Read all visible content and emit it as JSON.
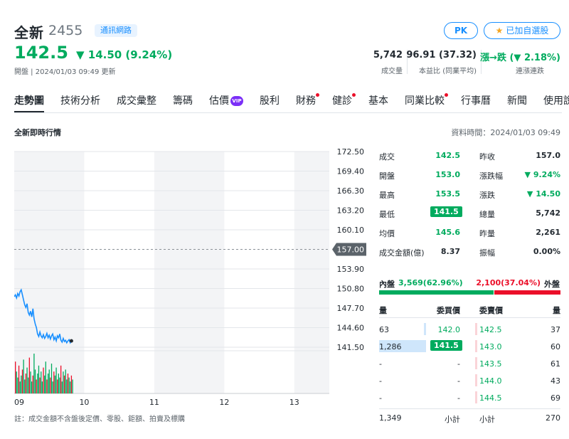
{
  "header": {
    "name": "全新",
    "code": "2455",
    "industry": "通訊網路",
    "price": "142.5",
    "change": "▼ 14.50 (9.24%)",
    "update": "開盤 | 2024/01/03 09:49 更新",
    "pk_label": "PK",
    "fav_star": "★",
    "fav_label": "已加自選股",
    "stats": [
      {
        "value": "5,742",
        "label": "成交量"
      },
      {
        "value": "96.91 (37.32)",
        "label": "本益比 (同業平均)"
      },
      {
        "value": "漲→跌 (▼ 2.18%)",
        "label": "連漲連跌"
      }
    ]
  },
  "tabs": [
    {
      "label": "走勢圖",
      "active": true
    },
    {
      "label": "技術分析"
    },
    {
      "label": "成交彙整"
    },
    {
      "label": "籌碼"
    },
    {
      "label": "估價",
      "vip": "VIP"
    },
    {
      "label": "股利"
    },
    {
      "label": "財務",
      "dot": true
    },
    {
      "label": "健診",
      "dot": true
    },
    {
      "label": "基本"
    },
    {
      "label": "同業比較",
      "dot": true
    },
    {
      "label": "行事曆"
    },
    {
      "label": "新聞"
    },
    {
      "label": "使用說明"
    }
  ],
  "section": {
    "title": "全新即時行情",
    "datatime": "資料時間：2024/01/03 09:49"
  },
  "chart_data": {
    "type": "line",
    "y_ticks": [
      "172.50",
      "169.40",
      "166.30",
      "163.20",
      "160.10",
      "157.00",
      "153.90",
      "150.80",
      "147.70",
      "144.60",
      "141.50"
    ],
    "ylim": [
      141.5,
      172.5
    ],
    "reference_price": "157.00",
    "x_ticks": [
      "09",
      "10",
      "11",
      "12",
      "13"
    ],
    "xlim_minutes": [
      0,
      270
    ],
    "line_color": "#188fff",
    "series": [
      {
        "x_minutes": [
          0,
          1,
          2,
          3,
          4,
          5,
          6,
          7,
          8,
          9,
          10,
          11,
          12,
          13,
          14,
          15,
          16,
          17,
          18,
          19,
          20,
          21,
          22,
          23,
          24,
          25,
          26,
          27,
          28,
          29,
          30,
          31,
          32,
          33,
          34,
          35,
          36,
          37,
          38,
          39,
          40,
          41,
          42,
          43,
          44,
          45,
          46,
          47,
          48,
          49
        ],
        "values": [
          149.5,
          149.8,
          149.3,
          150.0,
          149.6,
          150.3,
          150.6,
          149.8,
          149.0,
          148.2,
          147.8,
          148.4,
          147.0,
          146.6,
          147.2,
          146.3,
          147.6,
          146.0,
          145.2,
          144.6,
          143.6,
          143.2,
          143.9,
          143.3,
          143.0,
          143.5,
          142.9,
          143.2,
          143.7,
          143.0,
          143.4,
          142.8,
          143.3,
          143.6,
          142.7,
          143.1,
          142.5,
          143.3,
          143.0,
          143.6,
          142.6,
          142.3,
          142.9,
          142.4,
          142.6,
          142.2,
          142.5,
          142.7,
          142.2,
          142.5
        ]
      }
    ],
    "volume_bars": [
      80,
      55,
      40,
      70,
      30,
      45,
      60,
      85,
      35,
      50,
      65,
      40,
      90,
      55,
      30,
      45,
      100,
      60,
      35,
      50,
      70,
      40,
      55,
      30,
      65,
      45,
      80,
      35,
      50,
      60,
      40,
      75,
      30,
      55,
      45,
      65,
      35,
      50,
      40,
      70,
      30,
      55,
      45,
      60,
      35,
      50,
      40,
      30,
      45,
      35
    ]
  },
  "quote": {
    "rows": [
      {
        "l1": "成交",
        "v1": "142.5",
        "c1": "green",
        "l2": "昨收",
        "v2": "157.0",
        "c2": "dark"
      },
      {
        "l1": "開盤",
        "v1": "153.0",
        "c1": "green",
        "l2": "漲跌幅",
        "v2": "▼ 9.24%",
        "c2": "green"
      },
      {
        "l1": "最高",
        "v1": "153.5",
        "c1": "green",
        "l2": "漲跌",
        "v2": "▼ 14.50",
        "c2": "green"
      },
      {
        "l1": "最低",
        "v1": "141.5",
        "c1": "box",
        "l2": "總量",
        "v2": "5,742",
        "c2": "dark"
      },
      {
        "l1": "均價",
        "v1": "145.6",
        "c1": "green",
        "l2": "昨量",
        "v2": "2,261",
        "c2": "dark"
      },
      {
        "l1": "成交金額(億)",
        "v1": "8.37",
        "c1": "dark",
        "l2": "振幅",
        "v2": "0.00%",
        "c2": "dark"
      }
    ],
    "inner_label": "內盤",
    "inner_value": "3,569(62.96%)",
    "inner_pct": 62.96,
    "outer_value": "2,100(37.04%)",
    "outer_label": "外盤",
    "book_head": [
      "量",
      "委買價",
      "委賣價",
      "量"
    ],
    "book": [
      {
        "bv": "63",
        "bp": "142.0",
        "ap": "142.5",
        "av": "37",
        "bvfrac": 0.05
      },
      {
        "bv": "1,286",
        "bp": "141.5",
        "ap": "143.0",
        "av": "60",
        "bvfrac": 1.0,
        "bp_box": true
      },
      {
        "bv": "-",
        "bp": "-",
        "ap": "143.5",
        "av": "61"
      },
      {
        "bv": "-",
        "bp": "-",
        "ap": "144.0",
        "av": "43"
      },
      {
        "bv": "-",
        "bp": "-",
        "ap": "144.5",
        "av": "69"
      }
    ],
    "buy_total": "1,349",
    "buy_total_label": "小計",
    "sell_total_label": "小計",
    "sell_total": "270"
  },
  "note": "註：成交金額不含盤後定價、零股、鉅額、拍賣及標購"
}
